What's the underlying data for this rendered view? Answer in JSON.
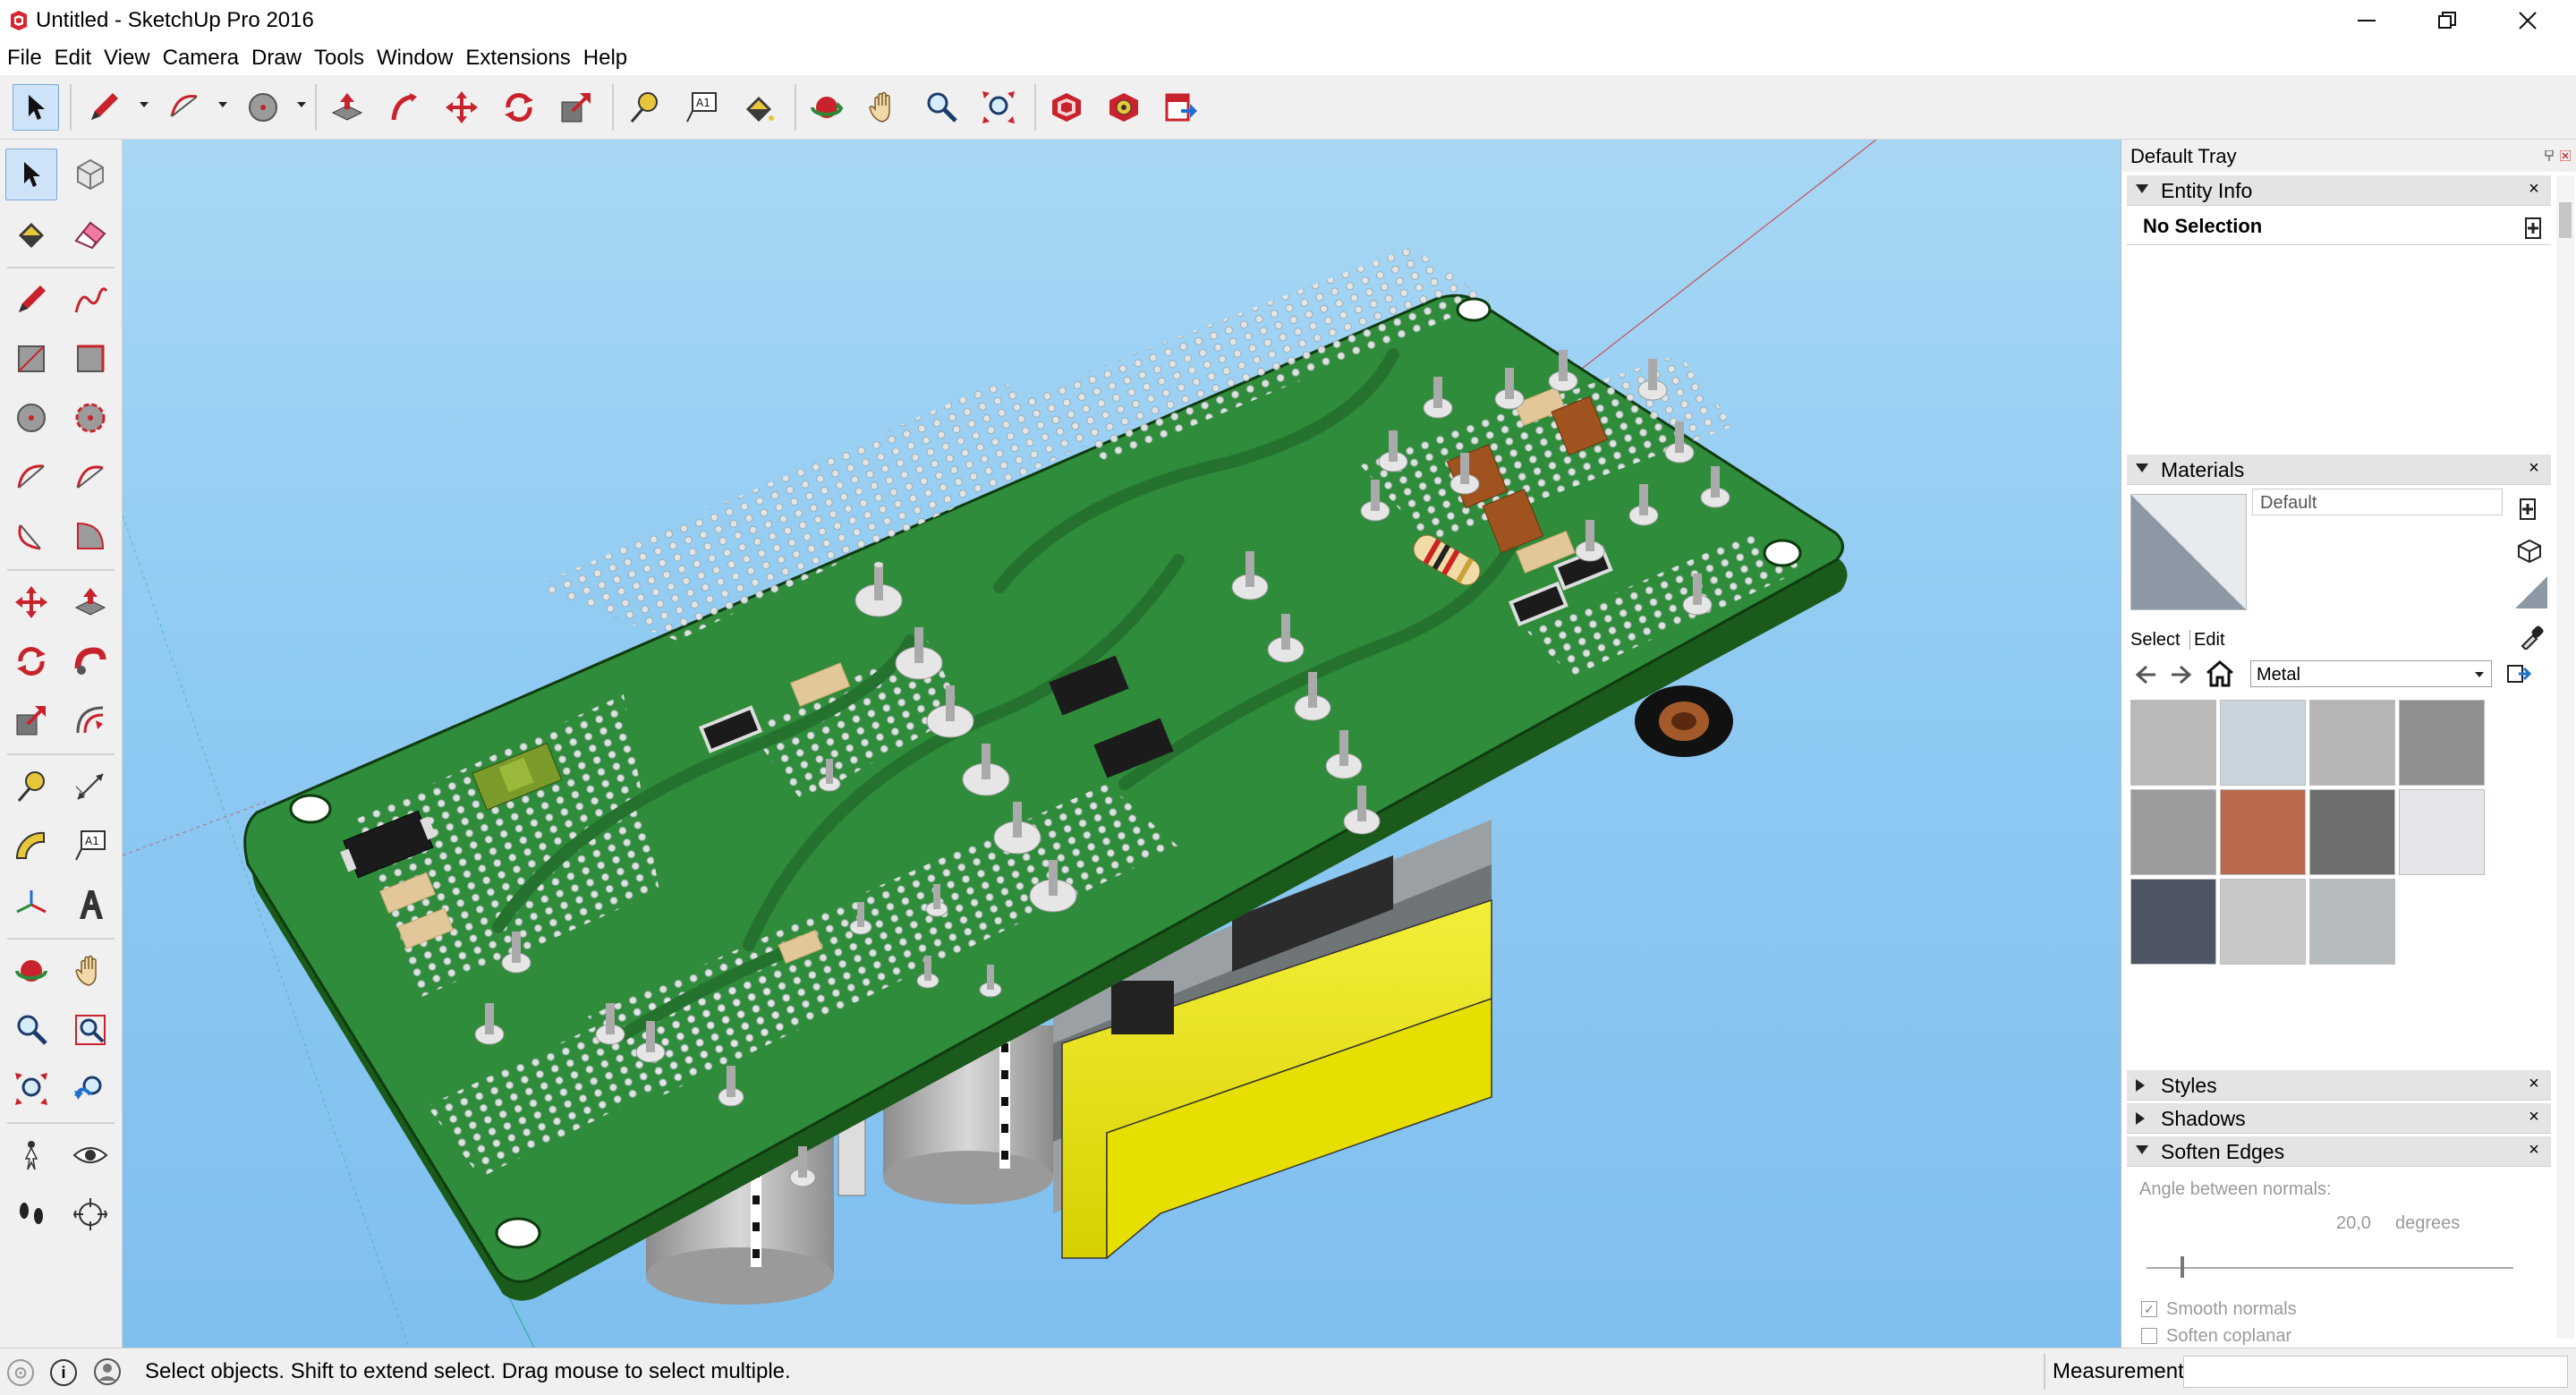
{
  "window": {
    "title": "Untitled - SketchUp Pro 2016"
  },
  "menu": [
    "File",
    "Edit",
    "View",
    "Camera",
    "Draw",
    "Tools",
    "Window",
    "Extensions",
    "Help"
  ],
  "toolbar_top": [
    {
      "name": "select-tool",
      "icon": "arrow-cursor-icon",
      "active": true
    },
    {
      "name": "line-tool",
      "icon": "pencil-icon"
    },
    {
      "name": "arc-tool",
      "icon": "arc-icon"
    },
    {
      "name": "circle-tool",
      "icon": "circle-icon"
    },
    {
      "name": "push-pull-tool",
      "icon": "push-pull-icon"
    },
    {
      "name": "follow-me-tool",
      "icon": "follow-me-icon"
    },
    {
      "name": "move-tool",
      "icon": "move-icon"
    },
    {
      "name": "rotate-tool",
      "icon": "rotate-icon"
    },
    {
      "name": "scale-tool",
      "icon": "scale-icon"
    },
    {
      "name": "tape-measure-tool",
      "icon": "tape-measure-icon"
    },
    {
      "name": "text-tool",
      "icon": "text-icon"
    },
    {
      "name": "paint-bucket-tool",
      "icon": "paint-bucket-icon"
    },
    {
      "name": "orbit-tool",
      "icon": "orbit-icon"
    },
    {
      "name": "pan-tool",
      "icon": "hand-icon"
    },
    {
      "name": "zoom-tool",
      "icon": "magnifier-icon"
    },
    {
      "name": "zoom-extents-tool",
      "icon": "zoom-extents-icon"
    },
    {
      "name": "3d-warehouse",
      "icon": "warehouse-icon"
    },
    {
      "name": "extension-warehouse",
      "icon": "extension-warehouse-icon"
    },
    {
      "name": "layout-send",
      "icon": "send-to-layout-icon"
    }
  ],
  "tray": {
    "title": "Default Tray",
    "entity_info": {
      "title": "Entity Info",
      "selection": "No Selection"
    },
    "materials": {
      "title": "Materials",
      "current": "Default",
      "tab_select": "Select",
      "tab_edit": "Edit",
      "library": "Metal",
      "swatch_colors": [
        "#b9b9b7",
        "#c8d4de",
        "#b5b5b5",
        "#8f8f8f",
        "#9a9c9e",
        "#b96a4e",
        "#6d6e6d",
        "#e5e6ea",
        "#4e5563",
        "#c8c8c8",
        "#b6bbbe"
      ]
    },
    "styles": {
      "title": "Styles"
    },
    "shadows": {
      "title": "Shadows"
    },
    "soften_edges": {
      "title": "Soften Edges",
      "angle_label": "Angle between normals:",
      "angle_value": "20,0",
      "angle_unit": "degrees",
      "smooth_normals": "Smooth normals",
      "soften_coplanar": "Soften coplanar"
    }
  },
  "status": {
    "message": "Select objects. Shift to extend select. Drag mouse to select multiple.",
    "measurements_label": "Measurements"
  }
}
